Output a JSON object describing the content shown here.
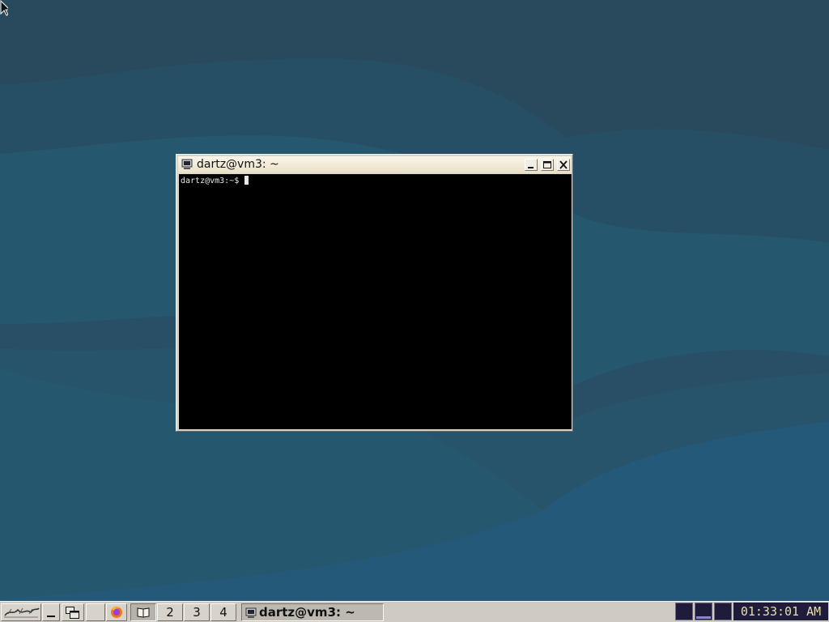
{
  "window": {
    "title": "dartz@vm3: ~",
    "prompt": "dartz@vm3:~$ "
  },
  "taskbar": {
    "workspaces": [
      "2",
      "3",
      "4"
    ],
    "active_task": "dartz@vm3: ~",
    "clock": "01:33:01 AM"
  },
  "icons": {
    "start": "icewm-logo-icon",
    "show_desktop": "minimize-icon",
    "window_list": "window-list-icon",
    "browser": "firefox-icon",
    "workspace_1": "book-icon",
    "terminal": "terminal-icon"
  },
  "colors": {
    "desktop": "#25576f",
    "terminal_bg": "#000000",
    "terminal_fg": "#e8e8e8",
    "titlebar": "#f4ecdc",
    "taskbar": "#cfcbc3",
    "monitor_bg": "#1f1b3a",
    "clock_fg": "#e8dfb0"
  }
}
